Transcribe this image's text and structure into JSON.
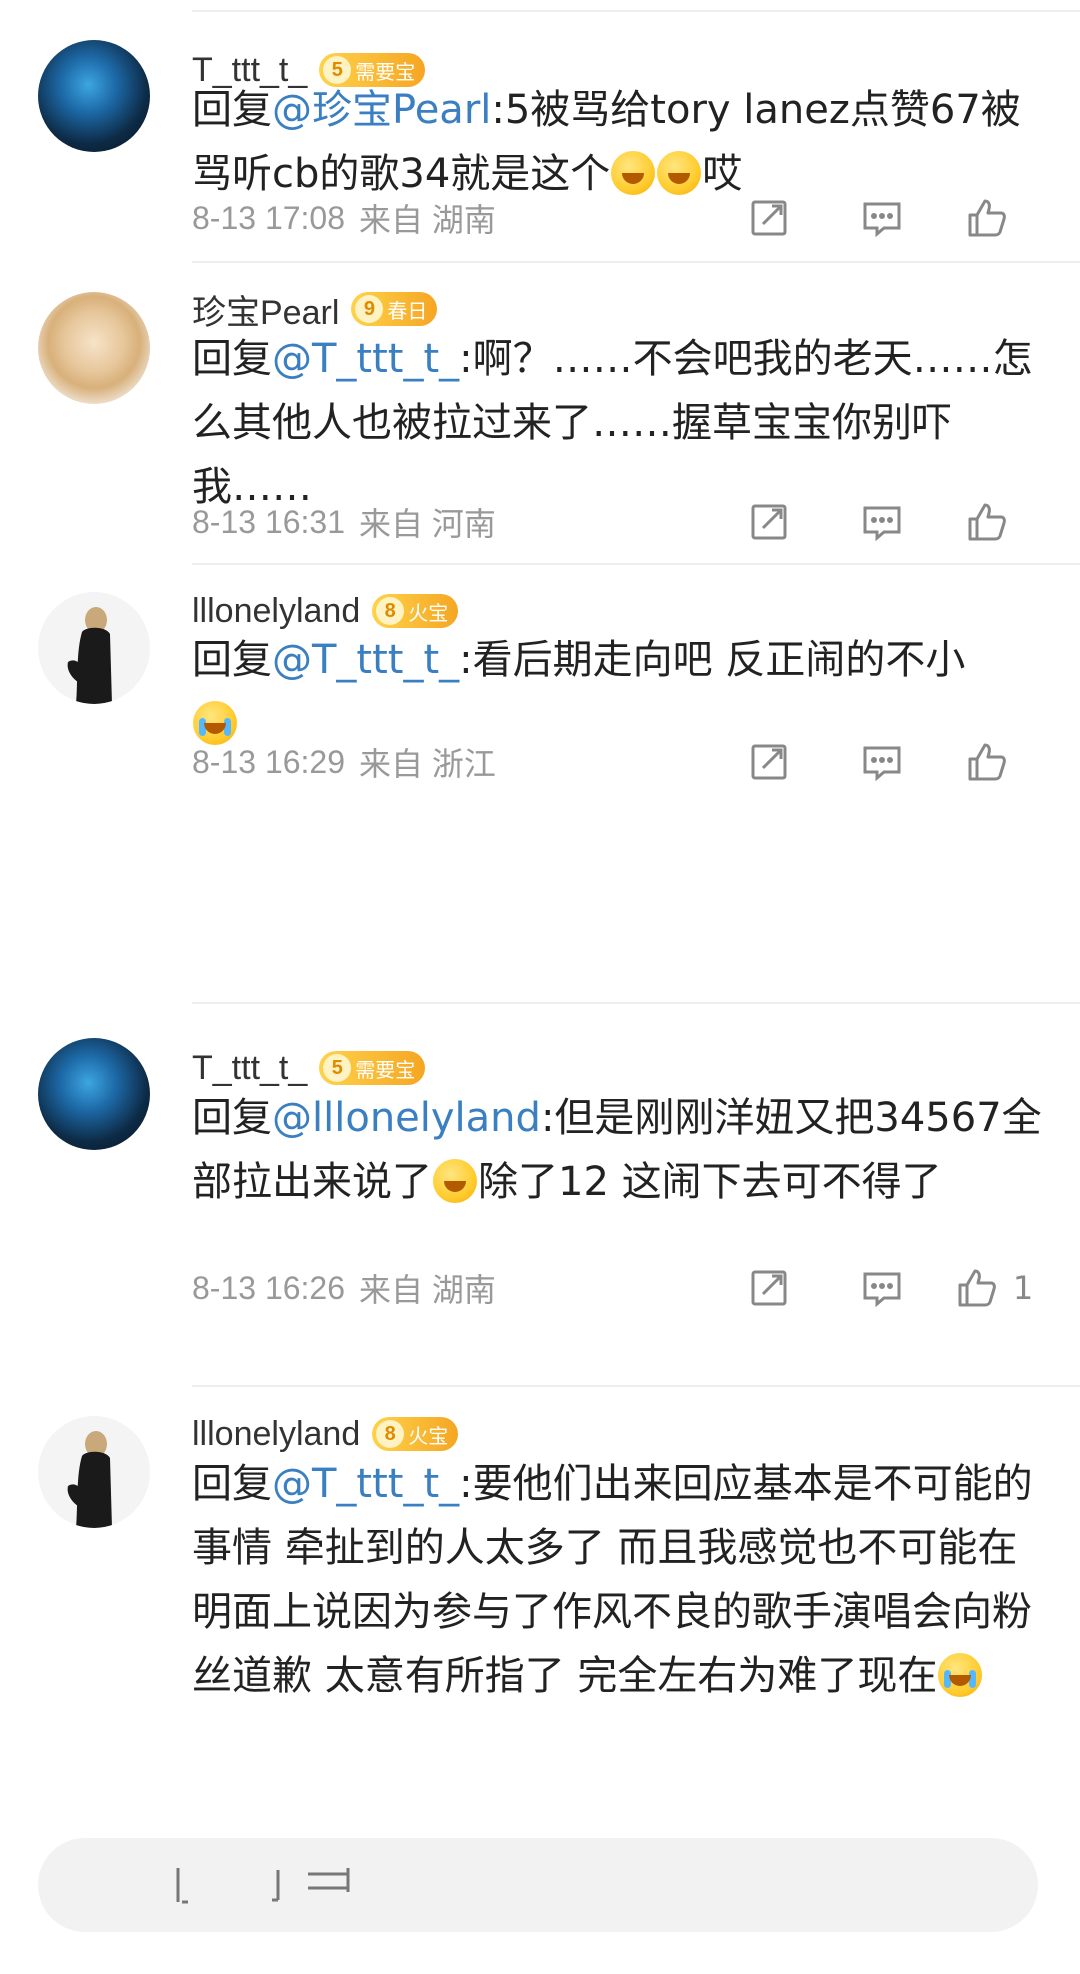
{
  "comments": [
    {
      "name": "T_ttt_t_",
      "badge_level": "5",
      "badge_text": "需要宝",
      "reply_prefix": "回复",
      "mention": "@珍宝Pearl",
      "body": ":5被骂给tory lanez点赞67被骂听cb的歌34就是这个",
      "emojis": [
        "laugh-cry",
        "laugh-cry"
      ],
      "body_tail": "哎",
      "date": "8-13 17:08",
      "location": "来自 湖南",
      "likes": ""
    },
    {
      "name": "珍宝Pearl",
      "badge_level": "9",
      "badge_text": "春日",
      "reply_prefix": "回复",
      "mention": "@T_ttt_t_",
      "body": ":啊？……不会吧我的老天……怎么其他人也被拉过来了……握草宝宝你别吓我……",
      "date": "8-13 16:31",
      "location": "来自 河南",
      "likes": ""
    },
    {
      "name": "lllonelyland",
      "badge_level": "8",
      "badge_text": "火宝",
      "reply_prefix": "回复",
      "mention": "@T_ttt_t_",
      "body": ":看后期走向吧 反正闹的不小",
      "emojis": [
        "cry"
      ],
      "date": "8-13 16:29",
      "location": "来自 浙江",
      "likes": ""
    },
    {
      "name": "T_ttt_t_",
      "badge_level": "5",
      "badge_text": "需要宝",
      "reply_prefix": "回复",
      "mention": "@lllonelyland",
      "body": ":但是刚刚洋妞又把34567全部拉出来说了",
      "emojis": [
        "laugh-cry"
      ],
      "body_tail": "除了12 这闹下去可不得了",
      "date": "8-13 16:26",
      "location": "来自 湖南",
      "likes": "1"
    },
    {
      "name": "lllonelyland",
      "badge_level": "8",
      "badge_text": "火宝",
      "reply_prefix": "回复",
      "mention": "@T_ttt_t_",
      "body": ":要他们出来回应基本是不可能的事情 牵扯到的人太多了 而且我感觉也不可能在明面上说因为参与了作风不良的歌手演唱会向粉丝道歉 太意有所指了 完全左右为难了现在",
      "emojis": [
        "cry"
      ]
    }
  ],
  "icons": {
    "share": "share-icon",
    "comment": "comment-icon",
    "like": "thumbs-up-icon"
  },
  "colors": {
    "mention": "#3a7fc2",
    "meta": "#999999",
    "badge": "#f5a623"
  }
}
